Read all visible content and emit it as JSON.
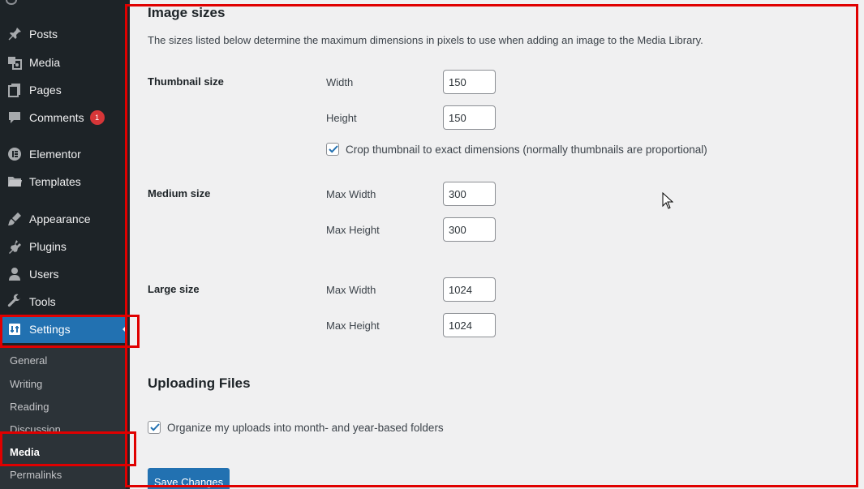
{
  "sidebar": {
    "items": [
      {
        "label": "Posts",
        "icon": "pin-icon"
      },
      {
        "label": "Media",
        "icon": "media-icon"
      },
      {
        "label": "Pages",
        "icon": "pages-icon"
      },
      {
        "label": "Comments",
        "icon": "comments-icon",
        "badge": "1"
      },
      {
        "label": "Elementor",
        "icon": "elementor-icon"
      },
      {
        "label": "Templates",
        "icon": "folder-icon"
      },
      {
        "label": "Appearance",
        "icon": "brush-icon"
      },
      {
        "label": "Plugins",
        "icon": "plugin-icon"
      },
      {
        "label": "Users",
        "icon": "user-icon"
      },
      {
        "label": "Tools",
        "icon": "wrench-icon"
      },
      {
        "label": "Settings",
        "icon": "settings-icon"
      }
    ],
    "submenu": [
      "General",
      "Writing",
      "Reading",
      "Discussion",
      "Media",
      "Permalinks"
    ]
  },
  "main": {
    "image_sizes_title": "Image sizes",
    "image_sizes_desc": "The sizes listed below determine the maximum dimensions in pixels to use when adding an image to the Media Library.",
    "thumbnail": {
      "heading": "Thumbnail size",
      "width_label": "Width",
      "width_value": "150",
      "height_label": "Height",
      "height_value": "150",
      "crop_label": "Crop thumbnail to exact dimensions (normally thumbnails are proportional)",
      "crop_checked": true
    },
    "medium": {
      "heading": "Medium size",
      "width_label": "Max Width",
      "width_value": "300",
      "height_label": "Max Height",
      "height_value": "300"
    },
    "large": {
      "heading": "Large size",
      "width_label": "Max Width",
      "width_value": "1024",
      "height_label": "Max Height",
      "height_value": "1024"
    },
    "uploading_title": "Uploading Files",
    "organize_label": "Organize my uploads into month- and year-based folders",
    "organize_checked": true,
    "save_label": "Save Changes"
  },
  "colors": {
    "sidebar_bg": "#1d2327",
    "accent": "#2271b1",
    "highlight": "#e00000",
    "badge": "#d63638"
  }
}
